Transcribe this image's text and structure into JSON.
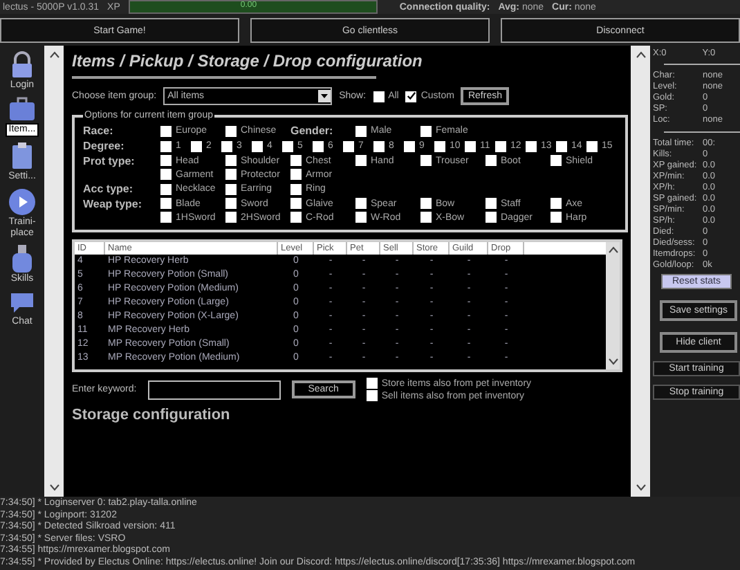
{
  "title_bar": {
    "title": "lectus - 5000P v1.0.31",
    "xp_label": "XP",
    "xp": {
      "text": "0.00",
      "level": 1
    },
    "connection_label": "Connection quality:",
    "avg": {
      "label": "Avg:",
      "value": "none"
    },
    "cur": {
      "label": "Cur:",
      "value": "none"
    }
  },
  "top_buttons": [
    "Start Game!",
    "Go clientless",
    "Disconnect"
  ],
  "sidebar": [
    {
      "label": "Login",
      "selected": false
    },
    {
      "label": "Item...",
      "selected": true
    },
    {
      "label": "Setti...",
      "selected": false
    },
    {
      "label": "Traini-\nplace",
      "selected": false
    },
    {
      "label": "Skills",
      "selected": false
    },
    {
      "label": "Chat",
      "selected": false
    }
  ],
  "page": {
    "title": "Items / Pickup / Storage / Drop configuration",
    "group_label": "Choose item group:",
    "group_value": "All items",
    "show_label": "Show:",
    "show": [
      {
        "label": "All",
        "checked": false
      },
      {
        "label": "Custom",
        "checked": true
      }
    ],
    "refresh": "Refresh",
    "options_title": "Options for current item group",
    "options": [
      {
        "label": "Race:",
        "items": [
          {
            "label": "Europe",
            "checked": false
          },
          {
            "label": "Chinese",
            "checked": false
          }
        ],
        "extra": {
          "label": "Gender:",
          "items": [
            {
              "label": "Male",
              "checked": false
            },
            {
              "label": "Female",
              "checked": false
            }
          ]
        }
      },
      {
        "label": "Degree:",
        "kind": "degree",
        "items": [
          {
            "label": "1",
            "checked": false
          },
          {
            "label": "2",
            "checked": false
          },
          {
            "label": "3",
            "checked": false
          },
          {
            "label": "4",
            "checked": false
          },
          {
            "label": "5",
            "checked": false
          },
          {
            "label": "6",
            "checked": false
          },
          {
            "label": "7",
            "checked": false
          },
          {
            "label": "8",
            "checked": false
          },
          {
            "label": "9",
            "checked": false
          },
          {
            "label": "10",
            "checked": false
          },
          {
            "label": "11",
            "checked": false
          },
          {
            "label": "12",
            "checked": false
          },
          {
            "label": "13",
            "checked": false
          },
          {
            "label": "14",
            "checked": false
          },
          {
            "label": "15",
            "checked": false
          }
        ]
      },
      {
        "label": "Prot type:",
        "items": [
          {
            "label": "Head",
            "checked": false
          },
          {
            "label": "Shoulder",
            "checked": false
          },
          {
            "label": "Chest",
            "checked": false
          },
          {
            "label": "Hand",
            "checked": false
          },
          {
            "label": "Trouser",
            "checked": false
          },
          {
            "label": "Boot",
            "checked": false
          },
          {
            "label": "Shield",
            "checked": false
          },
          {
            "label": "Garment",
            "checked": false
          },
          {
            "label": "Protector",
            "checked": false
          },
          {
            "label": "Armor",
            "checked": false
          }
        ]
      },
      {
        "label": "Acc type:",
        "items": [
          {
            "label": "Necklace",
            "checked": false
          },
          {
            "label": "Earring",
            "checked": false
          },
          {
            "label": "Ring",
            "checked": false
          }
        ]
      },
      {
        "label": "Weap type:",
        "items": [
          {
            "label": "Blade",
            "checked": false
          },
          {
            "label": "Sword",
            "checked": false
          },
          {
            "label": "Glaive",
            "checked": false
          },
          {
            "label": "Spear",
            "checked": false
          },
          {
            "label": "Bow",
            "checked": false
          },
          {
            "label": "Staff",
            "checked": false
          },
          {
            "label": "Axe",
            "checked": false
          },
          {
            "label": "1HSword",
            "checked": false
          },
          {
            "label": "2HSword",
            "checked": false
          },
          {
            "label": "C-Rod",
            "checked": false
          },
          {
            "label": "W-Rod",
            "checked": false
          },
          {
            "label": "X-Bow",
            "checked": false
          },
          {
            "label": "Dagger",
            "checked": false
          },
          {
            "label": "Harp",
            "checked": false
          }
        ]
      }
    ],
    "table": {
      "columns": [
        "ID",
        "Name",
        "Level",
        "Pick",
        "Pet",
        "Sell",
        "Store",
        "Guild",
        "Drop"
      ],
      "rows": [
        [
          "4",
          "HP Recovery Herb",
          "0",
          "-",
          "-",
          "-",
          "-",
          "-",
          "-"
        ],
        [
          "5",
          "HP Recovery Potion (Small)",
          "0",
          "-",
          "-",
          "-",
          "-",
          "-",
          "-"
        ],
        [
          "6",
          "HP Recovery Potion (Medium)",
          "0",
          "-",
          "-",
          "-",
          "-",
          "-",
          "-"
        ],
        [
          "7",
          "HP Recovery Potion (Large)",
          "0",
          "-",
          "-",
          "-",
          "-",
          "-",
          "-"
        ],
        [
          "8",
          "HP Recovery Potion (X-Large)",
          "0",
          "-",
          "-",
          "-",
          "-",
          "-",
          "-"
        ],
        [
          "11",
          "MP Recovery Herb",
          "0",
          "-",
          "-",
          "-",
          "-",
          "-",
          "-"
        ],
        [
          "12",
          "MP Recovery Potion (Small)",
          "0",
          "-",
          "-",
          "-",
          "-",
          "-",
          "-"
        ],
        [
          "13",
          "MP Recovery Potion (Medium)",
          "0",
          "-",
          "-",
          "-",
          "-",
          "-",
          "-"
        ]
      ]
    },
    "keyword_label": "Enter keyword:",
    "search": "Search",
    "pet_options": [
      {
        "label": "Store items also from pet inventory",
        "checked": false
      },
      {
        "label": "Sell items also from pet inventory",
        "checked": false
      }
    ],
    "next_section": "Storage configuration"
  },
  "right_panel": {
    "x": "X:0",
    "y": "Y:0",
    "char": [
      {
        "label": "Char:",
        "value": "none"
      },
      {
        "label": "Level:",
        "value": "none"
      },
      {
        "label": "Gold:",
        "value": "0"
      },
      {
        "label": "SP:",
        "value": "0"
      },
      {
        "label": "Loc:",
        "value": "none"
      }
    ],
    "stats": [
      {
        "label": "Total time:",
        "value": "00:"
      },
      {
        "label": "Kills:",
        "value": "0"
      },
      {
        "label": "XP gained:",
        "value": "0.0"
      },
      {
        "label": "XP/min:",
        "value": "0.0"
      },
      {
        "label": "XP/h:",
        "value": "0.0"
      },
      {
        "label": "SP gained:",
        "value": "0.0"
      },
      {
        "label": "SP/min:",
        "value": "0.0"
      },
      {
        "label": "SP/h:",
        "value": "0.0"
      },
      {
        "label": "Died:",
        "value": "0"
      },
      {
        "label": "Died/sess:",
        "value": "0"
      },
      {
        "label": "Itemdrops:",
        "value": "0"
      },
      {
        "label": "Gold/loop:",
        "value": "0k"
      }
    ],
    "buttons": [
      {
        "label": "Reset stats",
        "kind": "accent"
      },
      {
        "label": "Save settings",
        "kind": "boxed"
      },
      {
        "label": "Hide client",
        "kind": "boxed"
      },
      {
        "label": "Start training",
        "kind": "bar"
      },
      {
        "label": "Stop training",
        "kind": "bar"
      }
    ]
  },
  "log": [
    "7:34:50] * Loginserver 0: tab2.play-talla.online",
    "7:34:50] * Loginport: 31202",
    "7:34:50] * Detected Silkroad version: 411",
    "7:34:50] * Server files: VSRO",
    "7:34:55] https://mrexamer.blogspot.com",
    "7:34:55] * Provided by Electus Online: https://electus.online! Join our Discord: https://electus.online/discord[17:35:36] https://mrexamer.blogspot.com"
  ]
}
